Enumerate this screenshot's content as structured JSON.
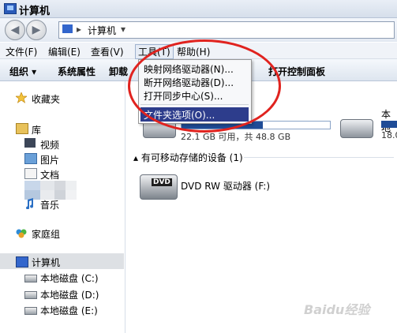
{
  "window": {
    "title": "计算机"
  },
  "address": {
    "path": "计算机",
    "separator": "▸",
    "dropdown": "▾"
  },
  "nav_buttons": {
    "back": "◀",
    "forward": "▶"
  },
  "menubar": {
    "items": [
      "文件(F)",
      "编辑(E)",
      "查看(V)",
      "工具(T)",
      "帮助(H)"
    ]
  },
  "toolbar": {
    "items": [
      "组织 ▾",
      "系统属性",
      "卸载",
      "打开控制面板"
    ]
  },
  "tools_menu": {
    "items": [
      "映射网络驱动器(N)...",
      "断开网络驱动器(D)...",
      "打开同步中心(S)...",
      "文件夹选项(O)..."
    ],
    "highlighted_index": 3
  },
  "nav": {
    "favorites": "收藏夹",
    "library": "库",
    "library_items": [
      "视频",
      "图片",
      "文档",
      "音乐"
    ],
    "homegroup": "家庭组",
    "computer": "计算机",
    "computer_items": [
      "本地磁盘 (C:)",
      "本地磁盘 (D:)",
      "本地磁盘 (E:)"
    ]
  },
  "content": {
    "drive1": {
      "info": "22.1 GB 可用，共 48.8 GB",
      "used_fraction": 0.55
    },
    "drive2": {
      "name_partial": "本地",
      "info_partial": "18.0"
    },
    "removable_header": "▴ 有可移动存储的设备 (1)",
    "dvd": {
      "name": "DVD RW 驱动器 (F:)",
      "badge": "DVD"
    }
  },
  "watermark": "Baidu经验",
  "colors": {
    "highlight": "#2d3d8c",
    "annotation": "#e0231f",
    "bar_fill": "#1f4c97"
  }
}
